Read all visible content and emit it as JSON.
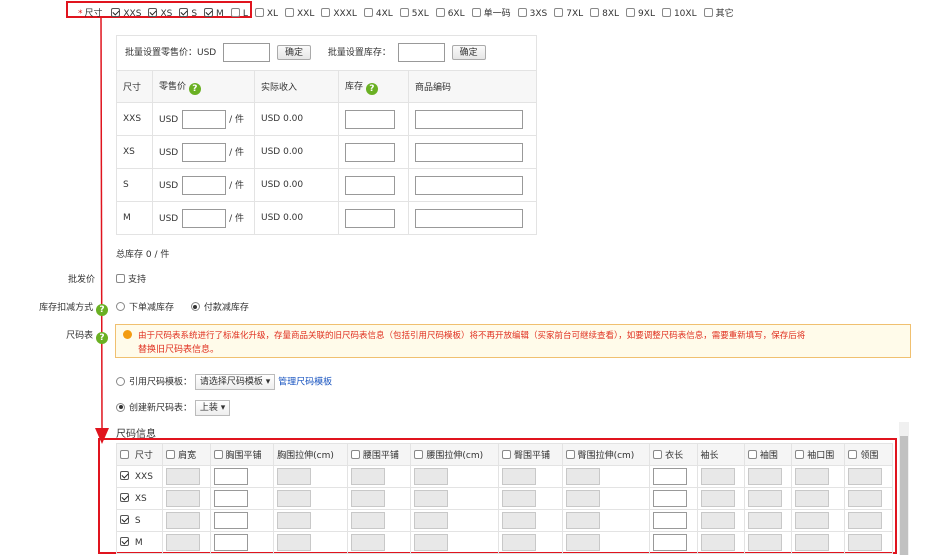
{
  "sizes": {
    "label": "尺寸",
    "options": [
      {
        "label": "XXS",
        "checked": true
      },
      {
        "label": "XS",
        "checked": true
      },
      {
        "label": "S",
        "checked": true
      },
      {
        "label": "M",
        "checked": true
      },
      {
        "label": "L",
        "checked": false
      },
      {
        "label": "XL",
        "checked": false
      },
      {
        "label": "XXL",
        "checked": false
      },
      {
        "label": "XXXL",
        "checked": false
      },
      {
        "label": "4XL",
        "checked": false
      },
      {
        "label": "5XL",
        "checked": false
      },
      {
        "label": "6XL",
        "checked": false
      },
      {
        "label": "单一码",
        "checked": false
      },
      {
        "label": "3XS",
        "checked": false
      },
      {
        "label": "7XL",
        "checked": false
      },
      {
        "label": "8XL",
        "checked": false
      },
      {
        "label": "9XL",
        "checked": false
      },
      {
        "label": "10XL",
        "checked": false
      },
      {
        "label": "其它",
        "checked": false
      }
    ]
  },
  "bulk": {
    "price_label": "批量设置零售价：USD",
    "confirm": "确定",
    "stock_label": "批量设置库存："
  },
  "sku_table": {
    "headers": {
      "size": "尺寸",
      "price": "零售价",
      "income": "实际收入",
      "stock": "库存",
      "code": "商品编码"
    },
    "currency": "USD",
    "unit": "/ 件",
    "rows": [
      {
        "size": "XXS",
        "income": "USD 0.00"
      },
      {
        "size": "XS",
        "income": "USD 0.00"
      },
      {
        "size": "S",
        "income": "USD 0.00"
      },
      {
        "size": "M",
        "income": "USD 0.00"
      }
    ],
    "total": "总库存 0 / 件"
  },
  "wholesale": {
    "label": "批发价",
    "option": "支持"
  },
  "stock_mode": {
    "label": "库存扣减方式",
    "opt1": "下单减库存",
    "opt2": "付款减库存"
  },
  "size_chart": {
    "label": "尺码表",
    "notice_line1": "由于尺码表系统进行了标准化升级，存量商品关联的旧尺码表信息（包括引用尺码模板）将不再开放编辑（买家前台可继续查看），如要调整尺码表信息，需要重新填写，保存后将",
    "notice_line2": "替换旧尺码表信息。",
    "ref_label": "引用尺码模板：",
    "ref_select": "请选择尺码模板",
    "manage_link": "管理尺码模板",
    "new_label": "创建新尺码表：",
    "new_select": "上装",
    "info_title": "尺码信息",
    "columns": [
      "尺寸",
      "肩宽",
      "胸围平铺",
      "胸围拉伸(cm)",
      "腰围平铺",
      "腰围拉伸(cm)",
      "臀围平铺",
      "臀围拉伸(cm)",
      "衣长",
      "袖长",
      "袖围",
      "袖口围",
      "领围"
    ],
    "rows": [
      "XXS",
      "XS",
      "S",
      "M"
    ]
  },
  "colors": {
    "highlight": "#e0141e",
    "help": "#6ab023",
    "notice_text": "#e03020"
  }
}
